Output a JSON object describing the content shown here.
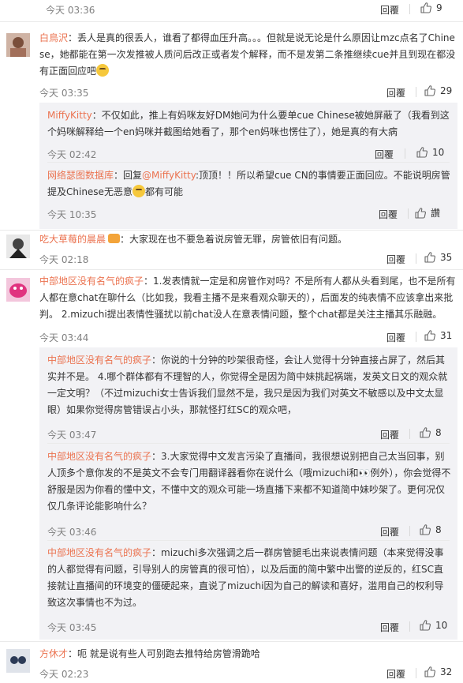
{
  "reply_label": "回覆",
  "colors": {
    "link": "#eb7350",
    "subbg": "#f2f2f5"
  },
  "comments": [
    {
      "time": "今天 03:36",
      "likes": "9"
    },
    {
      "author": "白鳥沢",
      "text": "：丢人是真的很丢人，谁看了都得血压升高。。。但就是说无论是什么原因让mzc点名了Chinese，她都能在第一次发推被人质问后改正或者发个解释，而不是发第二条推继续cue并且到现在都没有正面回应吧",
      "time": "今天 03:35",
      "likes": "29",
      "replies": [
        {
          "author": "MiffyKitty",
          "text": "：不仅如此，推上有妈咪友好DM她问为什么要单cue Chinese被她屏蔽了（我看到这个妈咪解释给一个en妈咪并截图给她看了，那个en妈咪也愣住了），她是真的有大病",
          "time": "今天 02:42",
          "likes": "10"
        },
        {
          "author": "网络瑟图数据库",
          "text_pre": "：回复",
          "mention": "@MiffyKitty",
          "text": ":顶顶！！所以希望cue CN的事情要正面回应。不能说明房管提及Chinese无恶意",
          "text_post": "都有可能",
          "time": "今天 10:35",
          "likes": "讚"
        }
      ]
    },
    {
      "author": "吃大草莓的晨晨",
      "text": "：大家现在也不要急着说房管无罪，房管依旧有问题。",
      "time": "今天 02:18",
      "likes": "35"
    },
    {
      "author": "中部地区没有名气的疯子",
      "text": "：1.发表情就一定是和房管作对吗？不是所有人都从头看到尾，也不是所有人都在意chat在聊什么（比如我，我看主播不是来看观众聊天的），后面发的纯表情不应该拿出来批判。  2.mizuchi提出表情性骚扰以前chat没人在意表情问题，整个chat都是关注主播其乐融融。",
      "time": "今天 03:44",
      "likes": "31",
      "replies": [
        {
          "author": "中部地区没有名气的疯子",
          "text": "：你说的十分钟的吵架很奇怪，会让人觉得十分钟直接占屏了，然后其实并不是。 4.哪个群体都有不理智的人，你觉得全是因为简中妹挑起祸端，发英文日文的观众就一定文明？（不过mizuchi女士告诉我们显然不是，我只是因为我们对英文不敏感以及中文太显眼）如果你觉得房管错误占小头，那就怪打红SC的观众吧，",
          "time": "今天 03:47",
          "likes": "8"
        },
        {
          "author": "中部地区没有名气的疯子",
          "text": "：3.大家觉得中文发言污染了直播间，我很想说别把自己太当回事，别人顶多个意你发的不是英文不会专门用翻译器看你在说什么（哦mizuchi和👀例外），你会觉得不舒服是因为你看的懂中文，不懂中文的观众可能一场直播下来都不知道简中妹吵架了。更何况仅仅几条评论能影响什么？",
          "time": "今天 03:46",
          "likes": "8"
        },
        {
          "author": "中部地区没有名气的疯子",
          "text": "：mizuchi多次强调之后一群房管腿毛出来说表情问题（本来觉得没事的人都觉得有问题，引导别人的房管真的很可怕），以及后面的简中繁中出警的逆反的，红SC直接就让直播间的环境变的僵硬起来，直说了mizuchi因为自己的解读和喜好，滥用自己的权利导致这次事情也不为过。",
          "time": "今天 03:45",
          "likes": "10"
        }
      ]
    },
    {
      "author": "方休才",
      "text": "：呃 就是说有些人可别跑去推特给房管滑跪哈",
      "time": "今天 02:23",
      "likes": "32"
    }
  ]
}
